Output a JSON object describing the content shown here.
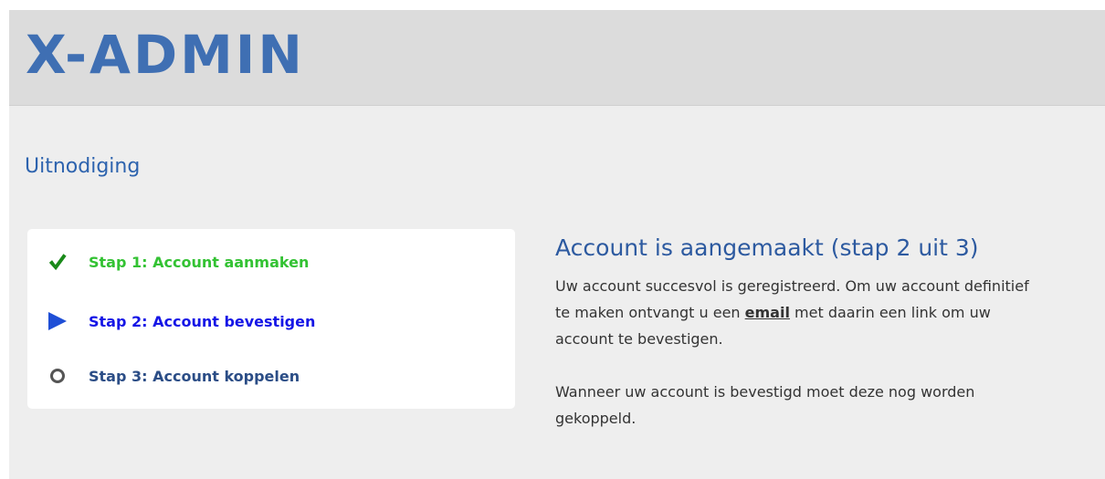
{
  "header": {
    "logo_text": "X-ADMIN"
  },
  "page": {
    "title": "Uitnodiging"
  },
  "steps": [
    {
      "label": "Stap 1: Account aanmaken",
      "state": "done",
      "icon": "checkmark-icon",
      "color": "#33c233"
    },
    {
      "label": "Stap 2: Account bevestigen",
      "state": "current",
      "icon": "play-arrow-icon",
      "color": "#1515e6"
    },
    {
      "label": "Stap 3: Account koppelen",
      "state": "pending",
      "icon": "circle-icon",
      "color": "#2b4d86"
    }
  ],
  "content": {
    "heading": "Account is aangemaakt (stap 2 uit 3)",
    "para1_before": "Uw account succesvol is geregistreerd. Om uw account definitief te maken ontvangt u een ",
    "para1_link": "email",
    "para1_after": " met daarin een link om uw account te bevestigen.",
    "para2": "Wanneer uw account is bevestigd moet deze nog worden gekoppeld."
  },
  "colors": {
    "brand": "#3f6fb3",
    "title": "#2d63ae"
  }
}
